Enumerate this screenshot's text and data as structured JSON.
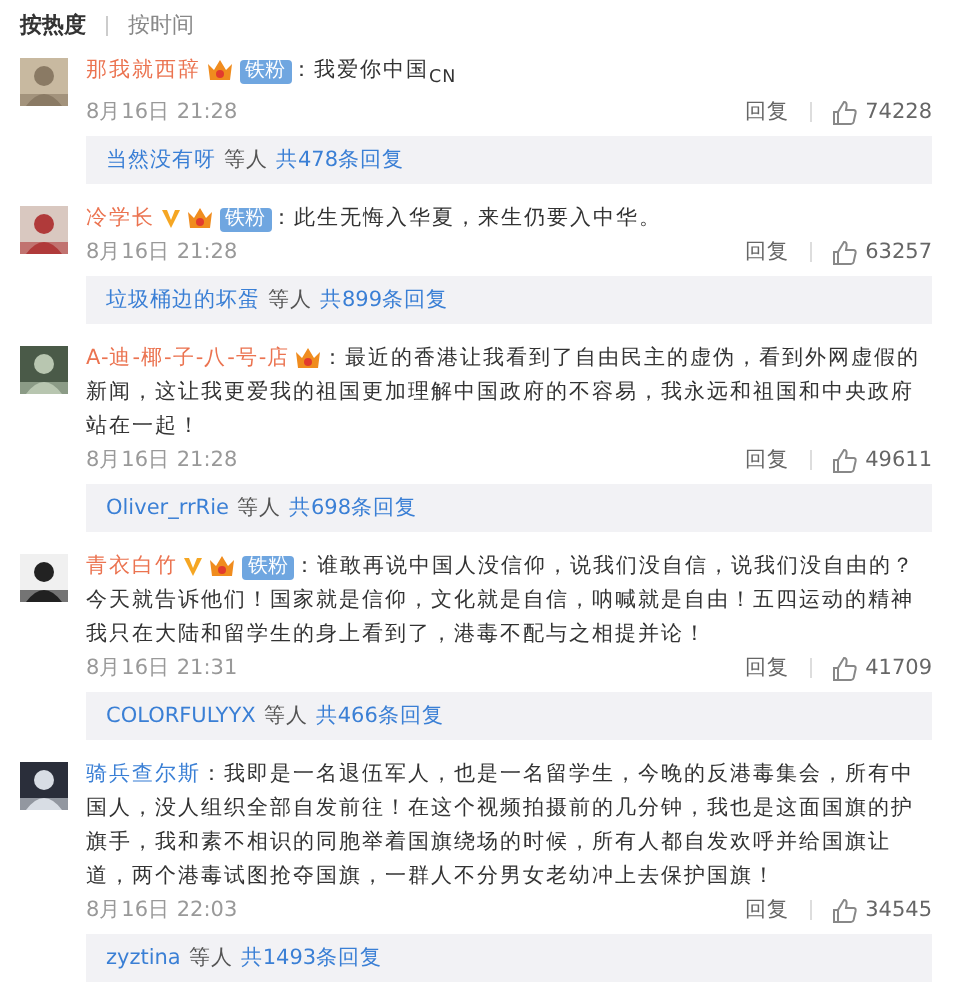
{
  "sort_tabs": [
    {
      "label": "按热度",
      "selected": true
    },
    {
      "label": "按时间",
      "selected": false
    }
  ],
  "comments": [
    {
      "author": "那我就西辞",
      "badges": [
        {
          "kind": "member"
        },
        {
          "kind": "fan",
          "text": "铁粉"
        }
      ],
      "text": "：我爱你中国$_{CN}$",
      "time": "8月16日 21:28",
      "reply_label": "回复",
      "likes": "74228",
      "thread": {
        "user": "当然没有呀",
        "others": "等人",
        "count": "共478条回复"
      }
    },
    {
      "author": "冷学长",
      "badges": [
        {
          "kind": "verified"
        },
        {
          "kind": "member"
        },
        {
          "kind": "fan",
          "text": "铁粉"
        }
      ],
      "text": "：此生无悔入华夏，来生仍要入中华。",
      "time": "8月16日 21:28",
      "reply_label": "回复",
      "likes": "63257",
      "thread": {
        "user": "垃圾桶边的坏蛋",
        "others": "等人",
        "count": "共899条回复"
      }
    },
    {
      "author": "A-迪-椰-子-八-号-店",
      "badges": [
        {
          "kind": "member"
        }
      ],
      "text": "：最近的香港让我看到了自由民主的虚伪，看到外网虚假的新闻，这让我更爱我的祖国更加理解中国政府的不容易，我永远和祖国和中央政府站在一起！",
      "time": "8月16日 21:28",
      "reply_label": "回复",
      "likes": "49611",
      "thread": {
        "user": "Oliver_rrRie",
        "others": "等人",
        "count": "共698条回复"
      }
    },
    {
      "author": "青衣白竹",
      "badges": [
        {
          "kind": "verified"
        },
        {
          "kind": "member"
        },
        {
          "kind": "fan",
          "text": "铁粉"
        }
      ],
      "text": "：谁敢再说中国人没信仰，说我们没自信，说我们没自由的？今天就告诉他们！国家就是信仰，文化就是自信，呐喊就是自由！五四运动的精神我只在大陆和留学生的身上看到了，港毒不配与之相提并论！",
      "time": "8月16日 21:31",
      "reply_label": "回复",
      "likes": "41709",
      "thread": {
        "user": "COLORFULYYX",
        "others": "等人",
        "count": "共466条回复"
      }
    },
    {
      "author": "骑兵查尔斯",
      "text": "：我即是一名退伍军人，也是一名留学生，今晚的反港毒集会，所有中国人，没人组织全部自发前往！在这个视频拍摄前的几分钟，我也是这面国旗的护旗手，我和素不相识的同胞举着国旗绕场的时候，所有人都自发欢呼并给国旗让道，两个港毒试图抢夺国旗，一群人不分男女老幼冲上去保护国旗！",
      "time": "8月16日 22:03",
      "reply_label": "回复",
      "likes": "34545",
      "thread": {
        "user": "zyztina",
        "others": "等人",
        "count": "共1493条回复"
      }
    }
  ]
}
